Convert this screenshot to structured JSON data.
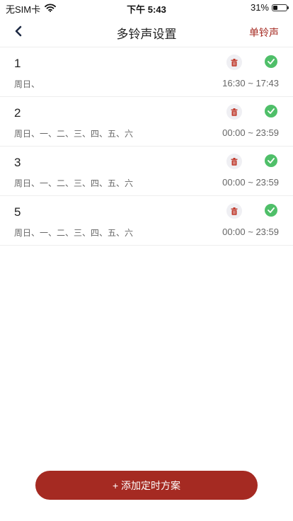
{
  "status_bar": {
    "carrier": "无SIM卡",
    "time": "下午 5:43",
    "battery_text": "31%",
    "battery_level": 0.31
  },
  "nav": {
    "title": "多铃声设置",
    "action": "单铃声",
    "back_icon": "chevron-left-icon"
  },
  "schedules": [
    {
      "name": "1",
      "days": "周日、",
      "time": "16:30 ~ 17:43",
      "enabled": true
    },
    {
      "name": "2",
      "days": "周日、一、二、三、四、五、六",
      "time": "00:00 ~ 23:59",
      "enabled": true
    },
    {
      "name": "3",
      "days": "周日、一、二、三、四、五、六",
      "time": "00:00 ~ 23:59",
      "enabled": true
    },
    {
      "name": "5",
      "days": "周日、一、二、三、四、五、六",
      "time": "00:00 ~ 23:59",
      "enabled": true
    }
  ],
  "add_button": {
    "label": "+ 添加定时方案"
  },
  "colors": {
    "accent": "#a52a22",
    "check": "#4fbf69",
    "delete_icon": "#c0392b",
    "delete_bg": "#efeff3"
  }
}
